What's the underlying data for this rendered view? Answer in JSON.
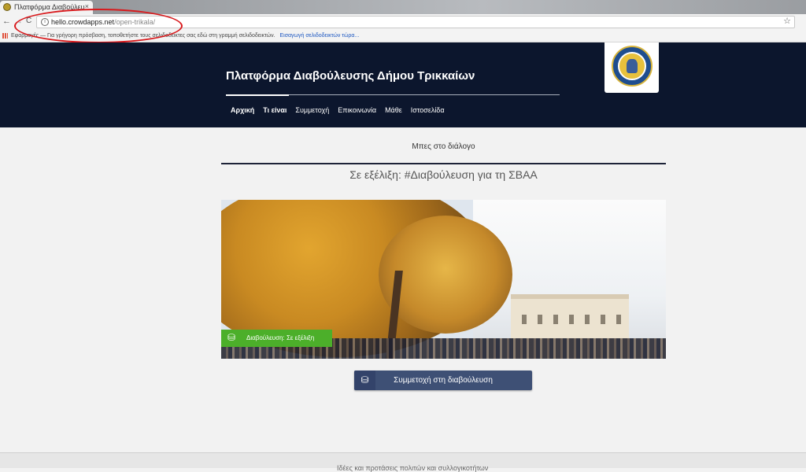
{
  "browser": {
    "tab_title": "Πλατφόρμα Διαβούλευ",
    "tab_close": "×",
    "back": "←",
    "forward": "→",
    "reload": "C",
    "url_host": "hello.crowdapps.net",
    "url_path": "/open-trikala/",
    "star": "☆",
    "bookmarks_text": "Εφαρμογές — Για γρήγορη πρόσβαση, τοποθετήστε τους σελιδοδείκτες σας εδώ στη γραμμή σελιδοδεικτών.",
    "bookmarks_link": "Εισαγωγή σελιδοδεικτών τώρα...",
    "annotation_color": "#d8191c"
  },
  "header": {
    "title": "Πλατφόρμα Διαβούλευσης Δήμου Τρικκαίων",
    "background": "#0c162d",
    "nav": [
      "Αρχική",
      "Τι είναι",
      "Συμμετοχή",
      "Επικοινωνία",
      "Μάθε",
      "Ιστοσελίδα"
    ]
  },
  "content": {
    "subtitle": "Μπες στο διάλογο",
    "heading": "Σε εξέλιξη: #Διαβούλευση για τη ΣΒΑΑ",
    "status_tag": "Διαβούλευση: Σε εξέλιξη",
    "status_color": "#4caf2a",
    "cta_label": "Συμμετοχή στη διαβούλευση",
    "cta_color": "#3e5075",
    "icon_glyph": "⛁"
  },
  "footer": {
    "text": "Ιδέες και προτάσεις πολιτών και συλλογικοτήτων"
  }
}
